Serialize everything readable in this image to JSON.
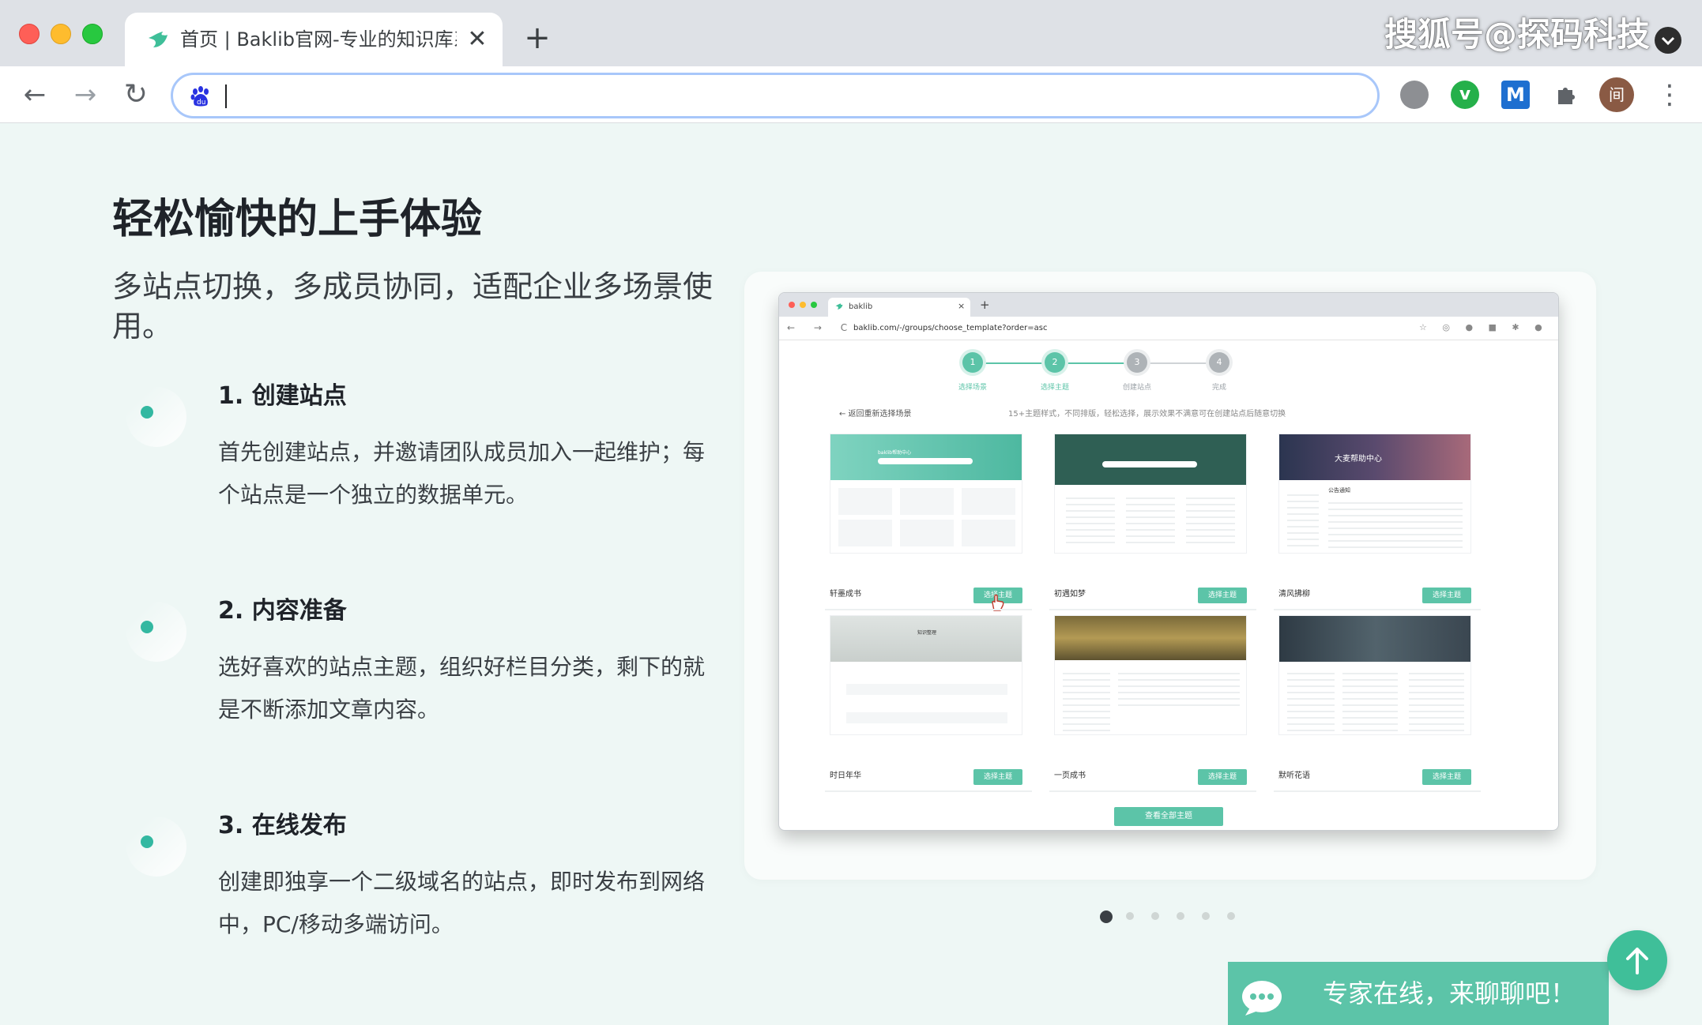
{
  "browser": {
    "tab_title": "首页 | Baklib官网-专业的知识库系统",
    "tab_close": "✕",
    "new_tab": "+",
    "address_value": "",
    "back": "←",
    "forward": "→",
    "reload": "↻",
    "menu": "⋮",
    "profile_initial": "间",
    "extensions": [
      "globe-icon",
      "v-extension-icon",
      "m-extension-icon",
      "puzzle-icon"
    ],
    "ext_v_label": "v",
    "ext_m_label": "M"
  },
  "watermark": "搜狐号@探码科技",
  "page": {
    "title": "轻松愉快的上手体验",
    "subtitle": "多站点切换，多成员协同，适配企业多场景使用。",
    "steps": [
      {
        "title": "1. 创建站点",
        "desc": "首先创建站点，并邀请团队成员加入一起维护；每个站点是一个独立的数据单元。"
      },
      {
        "title": "2. 内容准备",
        "desc": "选好喜欢的站点主题，组织好栏目分类，剩下的就是不断添加文章内容。"
      },
      {
        "title": "3. 在线发布",
        "desc": "创建即独享一个二级域名的站点，即时发布到网络中，PC/移动多端访问。"
      }
    ]
  },
  "screenshot": {
    "tab_label": "baklib",
    "tab_close": "×",
    "new_tab": "+",
    "nav": "← → C",
    "url": "baklib.com/-/groups/choose_template?order=asc",
    "ext_row": "☆ ◎ ● ■ ✱ ●  ⋮",
    "steps": [
      {
        "num": "1",
        "label": "选择场景"
      },
      {
        "num": "2",
        "label": "选择主题"
      },
      {
        "num": "3",
        "label": "创建站点"
      },
      {
        "num": "4",
        "label": "完成"
      }
    ],
    "back_link": "← 返回重新选择场景",
    "hint": "15+主题样式，不同排版，轻松选择，展示效果不满意可在创建站点后随意切换",
    "templates": [
      {
        "name": "轩墨成书",
        "button": "选择主题"
      },
      {
        "name": "初遇如梦",
        "button": "选择主题"
      },
      {
        "name": "清风拂柳",
        "button": "选择主题"
      },
      {
        "name": "时日年华",
        "button": "选择主题"
      },
      {
        "name": "一页成书",
        "button": "选择主题"
      },
      {
        "name": "默听花语",
        "button": "选择主题"
      }
    ],
    "thumb_text": {
      "t1_header": "baklib帮助中心",
      "t3_header": "大麦帮助中心",
      "t3_notice": "公告通知",
      "t4_header": "知识整理"
    },
    "view_all": "查看全部主题"
  },
  "carousel": {
    "count": 6,
    "active": 1
  },
  "chat": {
    "label": "专家在线，来聊聊吧！"
  },
  "colors": {
    "accent": "#5cc4a8",
    "page_bg": "#eef7f5",
    "title": "#1f2329"
  }
}
